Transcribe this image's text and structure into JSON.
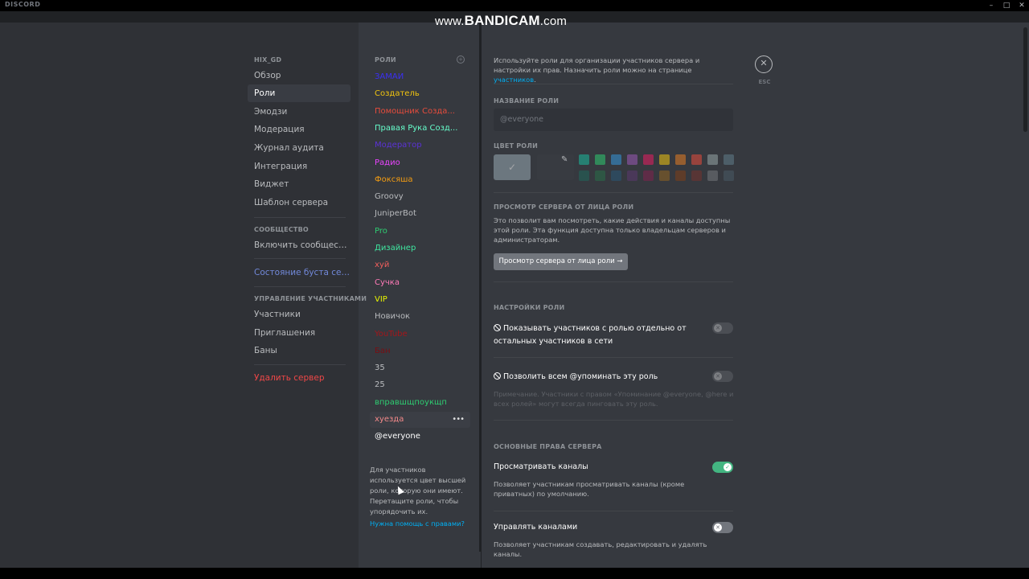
{
  "window": {
    "brand": "DISCORD",
    "minimize": "–",
    "maximize": "□",
    "close": "✕"
  },
  "watermark": {
    "prefix": "www.",
    "big": "BANDICAM",
    "suffix": ".com"
  },
  "sidebar": {
    "server_header": "HIX_GD",
    "items": [
      {
        "label": "Обзор"
      },
      {
        "label": "Роли"
      },
      {
        "label": "Эмодзи"
      },
      {
        "label": "Модерация"
      },
      {
        "label": "Журнал аудита"
      },
      {
        "label": "Интеграция"
      },
      {
        "label": "Виджет"
      },
      {
        "label": "Шаблон сервера"
      }
    ],
    "community_header": "СООБЩЕСТВО",
    "community_items": [
      {
        "label": "Включить сообщество"
      }
    ],
    "boost_label": "Состояние буста серв...",
    "members_header": "УПРАВЛЕНИЕ УЧАСТНИКАМИ",
    "member_items": [
      {
        "label": "Участники"
      },
      {
        "label": "Приглашения"
      },
      {
        "label": "Баны"
      }
    ],
    "delete_label": "Удалить сервер"
  },
  "roles": {
    "header": "РОЛИ",
    "add_icon": "plus-circle-icon",
    "list": [
      {
        "name": "ЗАМАИ",
        "color": "#3b2ff5"
      },
      {
        "name": "Создатель",
        "color": "#f1c40f"
      },
      {
        "name": "Помощник Созда...",
        "color": "#e74c3c"
      },
      {
        "name": "Правая Рука Созд...",
        "color": "#66ffcc"
      },
      {
        "name": "Модератор",
        "color": "#5b32d6"
      },
      {
        "name": "Радио",
        "color": "#ea44ff"
      },
      {
        "name": "Фоксяша",
        "color": "#f39c12"
      },
      {
        "name": "Groovy",
        "color": "#b9bbbe"
      },
      {
        "name": "JuniperBot",
        "color": "#b9bbbe"
      },
      {
        "name": "Pro",
        "color": "#2ecc71"
      },
      {
        "name": "Дизайнер",
        "color": "#3fe6a0"
      },
      {
        "name": "хуй",
        "color": "#f25f5c"
      },
      {
        "name": "Сучка",
        "color": "#ff7ab8"
      },
      {
        "name": "VIP",
        "color": "#e8f500"
      },
      {
        "name": "Новичок",
        "color": "#b9bbbe"
      },
      {
        "name": "YouTube",
        "color": "#a4161a"
      },
      {
        "name": "Бан",
        "color": "#7a0d12"
      },
      {
        "name": "35",
        "color": "#b9bbbe"
      },
      {
        "name": "25",
        "color": "#b9bbbe"
      },
      {
        "name": "вправшщпоукщп",
        "color": "#2ecc71"
      },
      {
        "name": "хуезда",
        "color": "#f48a8a"
      },
      {
        "name": "@everyone",
        "color": "#ffffff"
      }
    ],
    "more_dots": "•••",
    "note_text": "Для участников используется цвет высшей роли, которую они имеют. Перетащите роли, чтобы упорядочить их.",
    "help_link": "Нужна помощь с правами?"
  },
  "content": {
    "intro_text": "Используйте роли для организации участников сервера и настройки их прав. Назначить роли можно на странице ",
    "intro_link": "участников",
    "intro_end": ".",
    "role_name_header": "НАЗВАНИЕ РОЛИ",
    "role_name_value": "@everyone",
    "role_color_header": "ЦВЕТ РОЛИ",
    "swatch_check": "✓",
    "swatch_colors_row1": [
      "#1abc9c",
      "#2ecc71",
      "#3498db",
      "#9b59b6",
      "#e91e63",
      "#f1c40f",
      "#e67e22",
      "#e74c3c",
      "#95a5a6",
      "#607d8b"
    ],
    "swatch_colors_row2": [
      "#11806a",
      "#1f8b4c",
      "#206694",
      "#71368a",
      "#ad1457",
      "#c27c0e",
      "#a84300",
      "#992d22",
      "#979c9f",
      "#546e7a"
    ],
    "preview_header": "ПРОСМОТР СЕРВЕРА ОТ ЛИЦА РОЛИ",
    "preview_text": "Это позволит вам посмотреть, какие действия и каналы доступны этой роли. Эта функция доступна только владельцам серверов и администраторам.",
    "preview_button": "Просмотр сервера от лица роли →",
    "settings_header": "НАСТРОЙКИ РОЛИ",
    "hoist_label": "Показывать участников с ролью отдельно от остальных участников в сети",
    "mention_label": "Позволить всем @упоминать эту роль",
    "mention_note": "Примечание. Участники с правом «Упоминание @everyone, @here и всех ролей» могут всегда пинговать эту роль.",
    "perms_header": "ОСНОВНЫЕ ПРАВА СЕРВЕРА",
    "perm_view_label": "Просматривать каналы",
    "perm_view_desc": "Позволяет участникам просматривать каналы (кроме приватных) по умолчанию.",
    "perm_manage_label": "Управлять каналами",
    "perm_manage_desc": "Позволяет участникам создавать, редактировать и удалять каналы.",
    "toggle_off_glyph": "✕",
    "toggle_on_glyph": "✓",
    "close_glyph": "✕",
    "esc_label": "ESC"
  }
}
